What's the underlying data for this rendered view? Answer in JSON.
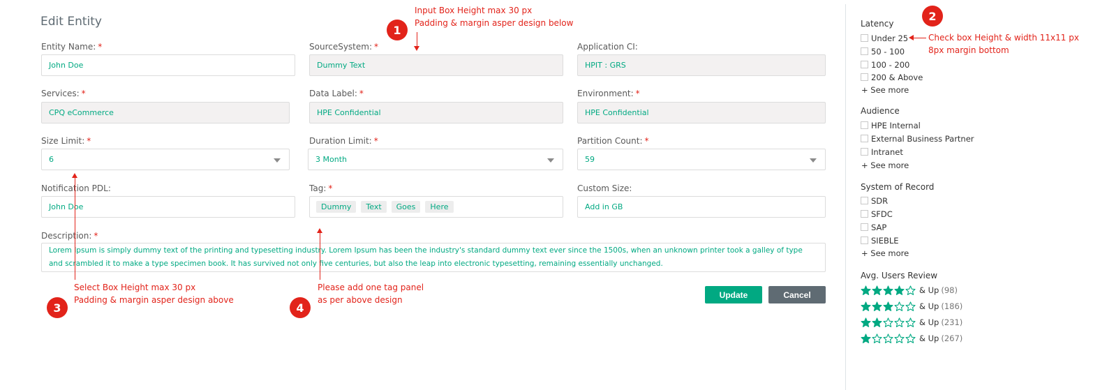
{
  "title": "Edit Entity",
  "fields": {
    "entity_name": {
      "label": "Entity Name:",
      "value": "John Doe"
    },
    "source_system": {
      "label": "SourceSystem:",
      "value": "Dummy Text"
    },
    "application_ci": {
      "label": "Application CI:",
      "value": "HPIT : GRS"
    },
    "services": {
      "label": "Services:",
      "value": "CPQ eCommerce"
    },
    "data_label": {
      "label": "Data Label:",
      "value": "HPE Confidential"
    },
    "environment": {
      "label": "Environment:",
      "value": "HPE Confidential"
    },
    "size_limit": {
      "label": "Size Limit:",
      "value": "6"
    },
    "duration_limit": {
      "label": "Duration Limit:",
      "value": "3 Month"
    },
    "partition_count": {
      "label": "Partition Count:",
      "value": "59"
    },
    "notification_pdl": {
      "label": "Notification PDL:",
      "value": "John Doe"
    },
    "tag": {
      "label": "Tag:",
      "tags": [
        "Dummy",
        "Text",
        "Goes",
        "Here"
      ]
    },
    "custom_size": {
      "label": "Custom Size:",
      "placeholder": "Add in GB"
    },
    "description": {
      "label": "Description:",
      "value": "Lorem Ipsum is simply dummy text of the printing and typesetting industry. Lorem Ipsum has been the industry's standard dummy text ever since the 1500s, when an unknown printer took a galley of type and scrambled it to make a type specimen book. It has survived not only five centuries, but also the leap into electronic typesetting, remaining essentially unchanged."
    }
  },
  "required_mark": "*",
  "buttons": {
    "update": "Update",
    "cancel": "Cancel"
  },
  "annotations": {
    "a1": {
      "number": "1",
      "line1": "Input Box Height max 30 px",
      "line2": "Padding & margin asper design below"
    },
    "a2": {
      "number": "2",
      "line1": "Check box Height & width 11x11 px",
      "line2": "8px margin bottom"
    },
    "a3": {
      "number": "3",
      "line1": "Select Box Height max 30 px",
      "line2": "Padding & margin asper design above"
    },
    "a4": {
      "number": "4",
      "line1": "Please add one tag panel",
      "line2": "as per above design"
    }
  },
  "sidebar": {
    "latency": {
      "heading": "Latency",
      "items": [
        "Under 25",
        "50 - 100",
        "100 - 200",
        "200 & Above"
      ],
      "see_more": "+ See more"
    },
    "audience": {
      "heading": "Audience",
      "items": [
        "HPE Internal",
        "External Business Partner",
        "Intranet"
      ],
      "see_more": "+ See more"
    },
    "system_of_record": {
      "heading": "System of Record",
      "items": [
        "SDR",
        "SFDC",
        "SAP",
        "SIEBLE"
      ],
      "see_more": "+ See more"
    },
    "reviews": {
      "heading": "Avg. Users Review",
      "suffix": "& Up",
      "rows": [
        {
          "stars": 4,
          "count": "(98)"
        },
        {
          "stars": 3,
          "count": "(186)"
        },
        {
          "stars": 2,
          "count": "(231)"
        },
        {
          "stars": 1,
          "count": "(267)"
        }
      ]
    }
  },
  "colors": {
    "accent": "#01a982",
    "annotation": "#e2231a",
    "cancel": "#5f6b73"
  },
  "icons": [
    "chevron-down-icon",
    "checkbox-icon",
    "star-filled-icon",
    "star-empty-icon"
  ]
}
